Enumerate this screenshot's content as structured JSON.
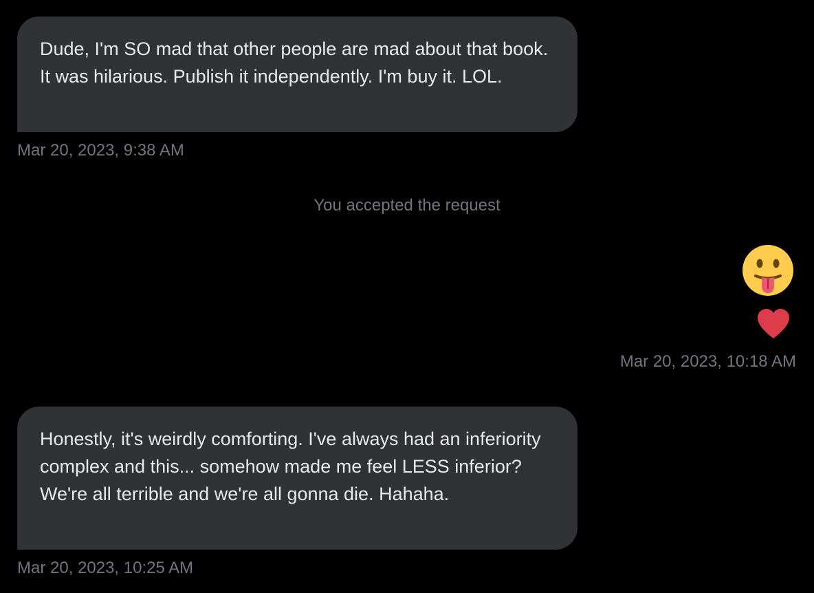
{
  "messages": [
    {
      "text": "Dude, I'm SO mad that other people are mad about that book. It was hilarious. Publish it independently. I'm buy it. LOL.",
      "timestamp": "Mar 20, 2023, 9:38 AM"
    },
    {
      "text": "Honestly, it's weirdly comforting. I've always had an inferiority complex and this... somehow made me feel LESS inferior? We're all terrible and we're all gonna die. Hahaha.",
      "timestamp": "Mar 20, 2023, 10:25 AM"
    }
  ],
  "system_note": "You accepted the request",
  "sent": {
    "emoji": "face-with-tongue-icon",
    "reaction": "heart-icon",
    "timestamp": "Mar 20, 2023, 10:18 AM"
  },
  "colors": {
    "background": "#000000",
    "bubble": "#2f3336",
    "text": "#e7e9ea",
    "muted": "#71767b",
    "heart": "#dd3c4a"
  }
}
